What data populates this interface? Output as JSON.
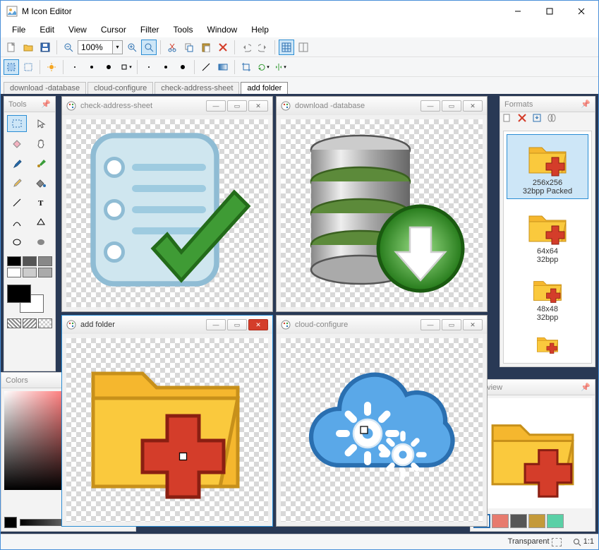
{
  "app": {
    "title": "M Icon Editor"
  },
  "menus": [
    "File",
    "Edit",
    "View",
    "Cursor",
    "Filter",
    "Tools",
    "Window",
    "Help"
  ],
  "zoom": {
    "value": "100%"
  },
  "doc_tabs": [
    {
      "label": "download -database",
      "active": false
    },
    {
      "label": "cloud-configure",
      "active": false
    },
    {
      "label": "check-address-sheet",
      "active": false
    },
    {
      "label": "add folder",
      "active": true
    }
  ],
  "panels": {
    "tools": {
      "title": "Tools"
    },
    "colors": {
      "title": "Colors"
    },
    "formats": {
      "title": "Formats",
      "items": [
        {
          "line1": "256x256",
          "line2": "32bpp Packed",
          "selected": true
        },
        {
          "line1": "64x64",
          "line2": "32bpp",
          "selected": false
        },
        {
          "line1": "48x48",
          "line2": "32bpp",
          "selected": false
        }
      ]
    },
    "preview": {
      "title": "Preview"
    }
  },
  "mdi": {
    "check_sheet": {
      "title": "check-address-sheet"
    },
    "download_db": {
      "title": "download -database"
    },
    "add_folder": {
      "title": "add folder"
    },
    "cloud_cfg": {
      "title": "cloud-configure"
    }
  },
  "status": {
    "transparent": "Transparent",
    "zoom_ratio": "1:1"
  },
  "preview_colors": [
    "#ffffff",
    "#e77b6e",
    "#565656",
    "#c49a3a",
    "#5ad0a6"
  ]
}
